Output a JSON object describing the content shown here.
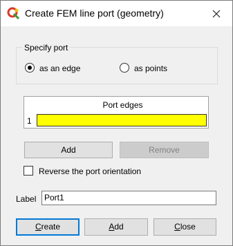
{
  "window": {
    "title": "Create FEM line port (geometry)",
    "app_icon": "qa-app-logo-icon",
    "close_icon": "close-icon"
  },
  "specify_port": {
    "title": "Specify port",
    "options": [
      {
        "label": "as an edge",
        "selected": true
      },
      {
        "label": "as points",
        "selected": false
      }
    ]
  },
  "port_edges_table": {
    "header": "Port edges",
    "rows": [
      {
        "num": "1",
        "value": "",
        "highlight_color": "#ffff00"
      }
    ]
  },
  "buttons": {
    "add": "Add",
    "remove": "Remove"
  },
  "reverse": {
    "label": "Reverse the port orientation",
    "checked": false
  },
  "label_field": {
    "label": "Label",
    "value": "Port1"
  },
  "footer": {
    "create": {
      "pre": "",
      "ul": "C",
      "post": "reate"
    },
    "add": {
      "pre": "",
      "ul": "A",
      "post": "dd"
    },
    "close": {
      "pre": "",
      "ul": "C",
      "post": "lose"
    }
  },
  "colors": {
    "accent": "#0078d7",
    "highlight": "#ffff00"
  }
}
